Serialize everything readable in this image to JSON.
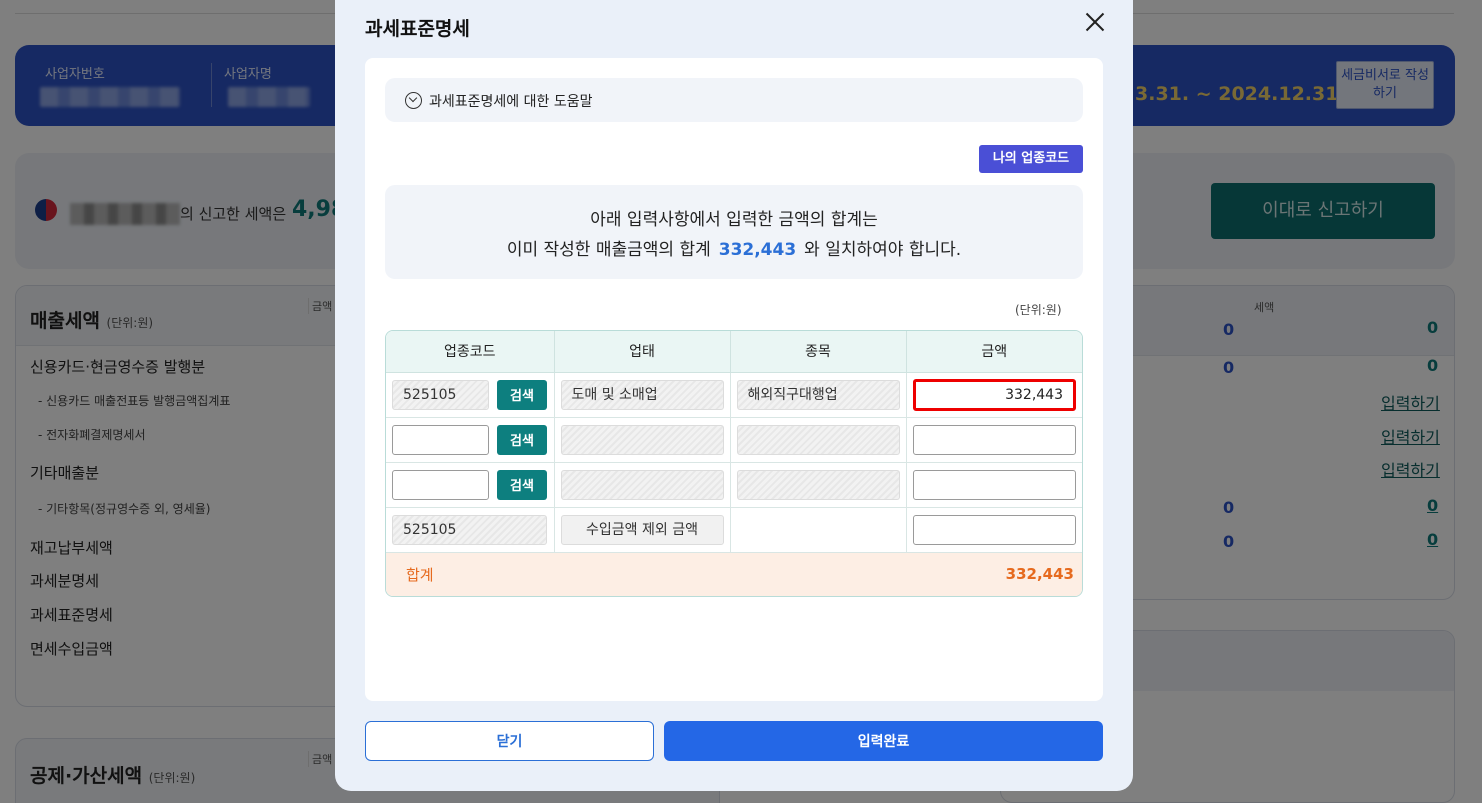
{
  "background": {
    "header": {
      "business_number_label": "사업자번호",
      "business_name_label": "사업자명",
      "period": "3.31. ~ 2024.12.31.",
      "invoice_button": "세금비서로 작성하기"
    },
    "tax_panel": {
      "reported_text": "의 신고한 세액은",
      "amount": "4,98",
      "submit_button": "이대로 신고하기"
    },
    "sales_card": {
      "title": "매출세액",
      "unit": "(단위:원)",
      "column_amount": "금액",
      "rows": [
        {
          "label": "신용카드·현금영수증 발행분",
          "sub": false
        },
        {
          "label": "- 신용카드 매출전표등 발행금액집계표",
          "sub": true
        },
        {
          "label": "- 전자화폐결제명세서",
          "sub": true
        },
        {
          "label": "기타매출분",
          "sub": false
        },
        {
          "label": "- 기타항목(정규영수증 외, 영세율)",
          "sub": true
        },
        {
          "label": "재고납부세액",
          "sub": false
        },
        {
          "label": "과세분명세",
          "sub": false
        },
        {
          "label": "과세표준명세",
          "sub": false
        },
        {
          "label": "면세수입금액",
          "sub": false
        }
      ]
    },
    "right_card": {
      "column_tax": "세액",
      "header_values": [
        "0",
        "0"
      ],
      "row_values": [
        "0",
        "0"
      ],
      "input_link": "입력하기",
      "bottom_values": [
        [
          "0",
          "0"
        ],
        [
          "0",
          "0"
        ]
      ]
    },
    "deduction_card": {
      "title": "공제·가산세액",
      "unit": "(단위:원)",
      "column_amount": "금액"
    }
  },
  "modal": {
    "title": "과세표준명세",
    "help_text": "과세표준명세에 대한 도움말",
    "my_code_button": "나의 업종코드",
    "notice_line1": "아래 입력사항에서 입력한 금액의 합계는",
    "notice_line2_pre": "이미 작성한 매출금액의 합계",
    "notice_amount": "332,443",
    "notice_line2_post": "와 일치하여야 합니다.",
    "unit": "(단위:원)",
    "table": {
      "headers": [
        "업종코드",
        "업태",
        "종목",
        "금액"
      ],
      "search_label": "검색",
      "rows": [
        {
          "code": "525105",
          "type": "도매 및 소매업",
          "item": "해외직구대행업",
          "amount": "332,443"
        },
        {
          "code": "",
          "type": "",
          "item": "",
          "amount": ""
        },
        {
          "code": "",
          "type": "",
          "item": "",
          "amount": ""
        },
        {
          "code": "525105",
          "type": "수입금액 제외 금액",
          "item": "",
          "amount": ""
        }
      ],
      "total_label": "합계",
      "total_value": "332,443"
    },
    "close_button": "닫기",
    "done_button": "입력완료"
  }
}
